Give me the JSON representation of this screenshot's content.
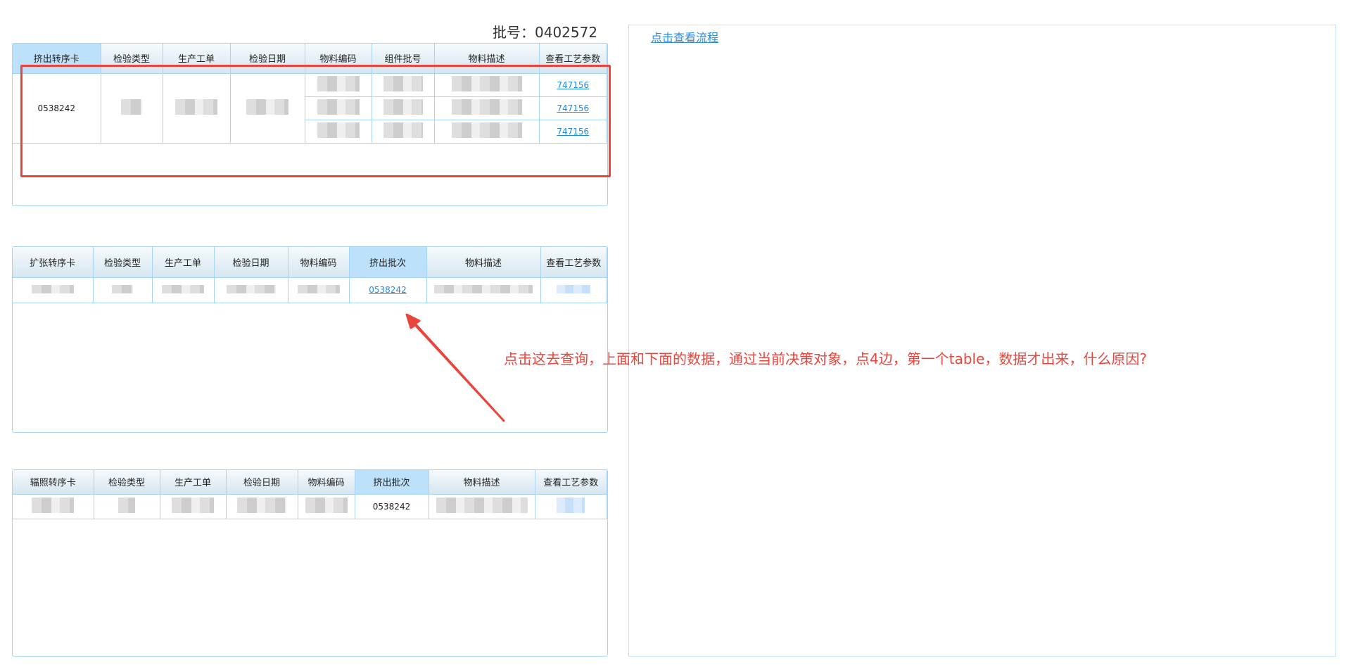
{
  "batch_label": "批号：0402572",
  "flow_link": "点击查看流程",
  "annotation": "点击这去查询，上面和下面的数据，通过当前决策对象，点4边，第一个table，数据才出来，什么原因?",
  "table1": {
    "headers": [
      "挤出转序卡",
      "检验类型",
      "生产工单",
      "检验日期",
      "物料编码",
      "组件批号",
      "物料描述",
      "查看工艺参数"
    ],
    "card": "0538242",
    "links": [
      "747156",
      "747156",
      "747156"
    ]
  },
  "table2": {
    "headers": [
      "扩张转序卡",
      "检验类型",
      "生产工单",
      "检验日期",
      "物料编码",
      "挤出批次",
      "物料描述",
      "查看工艺参数"
    ],
    "batch": "0538242"
  },
  "table3": {
    "headers": [
      "辐照转序卡",
      "检验类型",
      "生产工单",
      "检验日期",
      "物料编码",
      "挤出批次",
      "物料描述",
      "查看工艺参数"
    ],
    "batch": "0538242"
  },
  "colors": {
    "accent": "#1e88e5",
    "annotation": "#e8453c",
    "border": "#a9d3f5"
  }
}
